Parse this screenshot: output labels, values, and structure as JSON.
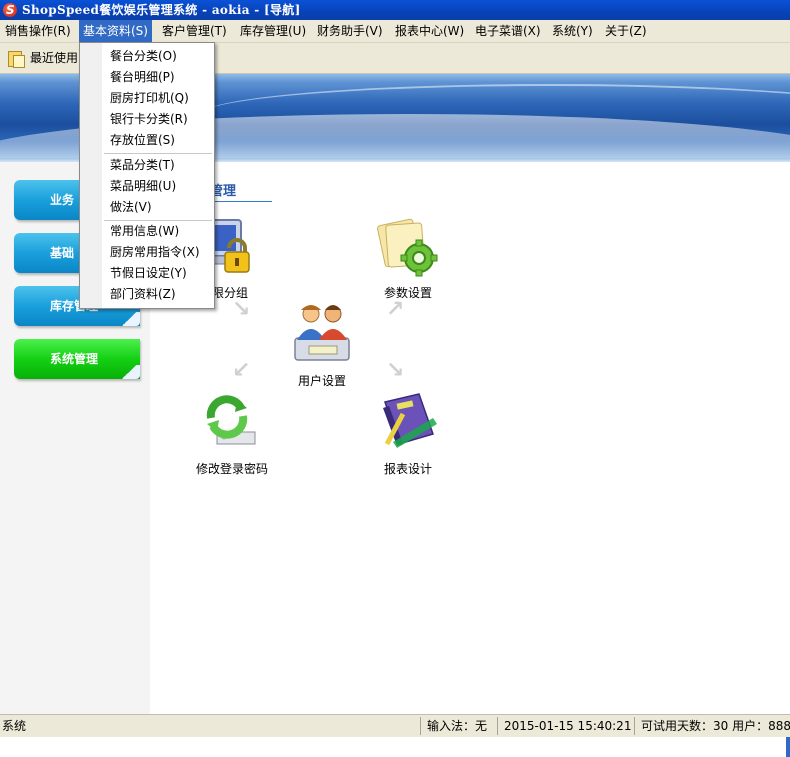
{
  "window": {
    "title": "ShopSpeed餐饮娱乐管理系统 - aokia - [导航]",
    "icon": "app-logo-icon"
  },
  "menubar": {
    "items": [
      {
        "label": "销售操作(R)"
      },
      {
        "label": "基本资料(S)"
      },
      {
        "label": "客户管理(T)"
      },
      {
        "label": "库存管理(U)"
      },
      {
        "label": "财务助手(V)"
      },
      {
        "label": "报表中心(W)"
      },
      {
        "label": "电子菜谱(X)"
      },
      {
        "label": "系统(Y)"
      },
      {
        "label": "关于(Z)"
      }
    ],
    "active_index": 1
  },
  "toolbar": {
    "recent_label": "最近使用"
  },
  "dropdown": {
    "groups": [
      [
        {
          "label": "餐台分类(O)"
        },
        {
          "label": "餐台明细(P)"
        },
        {
          "label": "厨房打印机(Q)"
        },
        {
          "label": "银行卡分类(R)"
        },
        {
          "label": "存放位置(S)"
        }
      ],
      [
        {
          "label": "菜品分类(T)"
        },
        {
          "label": "菜品明细(U)"
        },
        {
          "label": "做法(V)"
        }
      ],
      [
        {
          "label": "常用信息(W)"
        },
        {
          "label": "厨房常用指令(X)"
        },
        {
          "label": "节假日设定(Y)"
        },
        {
          "label": "部门资料(Z)"
        }
      ]
    ]
  },
  "leftnav": {
    "items": [
      {
        "label": "业务",
        "color": "blue"
      },
      {
        "label": "基础",
        "color": "blue"
      },
      {
        "label": "库存管理",
        "color": "blue"
      },
      {
        "label": "系统管理",
        "color": "green"
      }
    ]
  },
  "main": {
    "section_title": "管理",
    "tiles": {
      "permission": "权限分组",
      "params": "参数设置",
      "users": "用户设置",
      "password": "修改登录密码",
      "report": "报表设计"
    }
  },
  "statusbar": {
    "left": "系统",
    "ime": "输入法：无",
    "datetime": "2015-01-15 15:40:21",
    "trial": "可试用天数：30 用户：888"
  },
  "colors": {
    "titlebar": "#0a52d6",
    "menu_highlight": "#316ac5",
    "nav_blue": "#1aa0dc",
    "nav_green": "#14d014",
    "section_title": "#2a5aa8"
  }
}
